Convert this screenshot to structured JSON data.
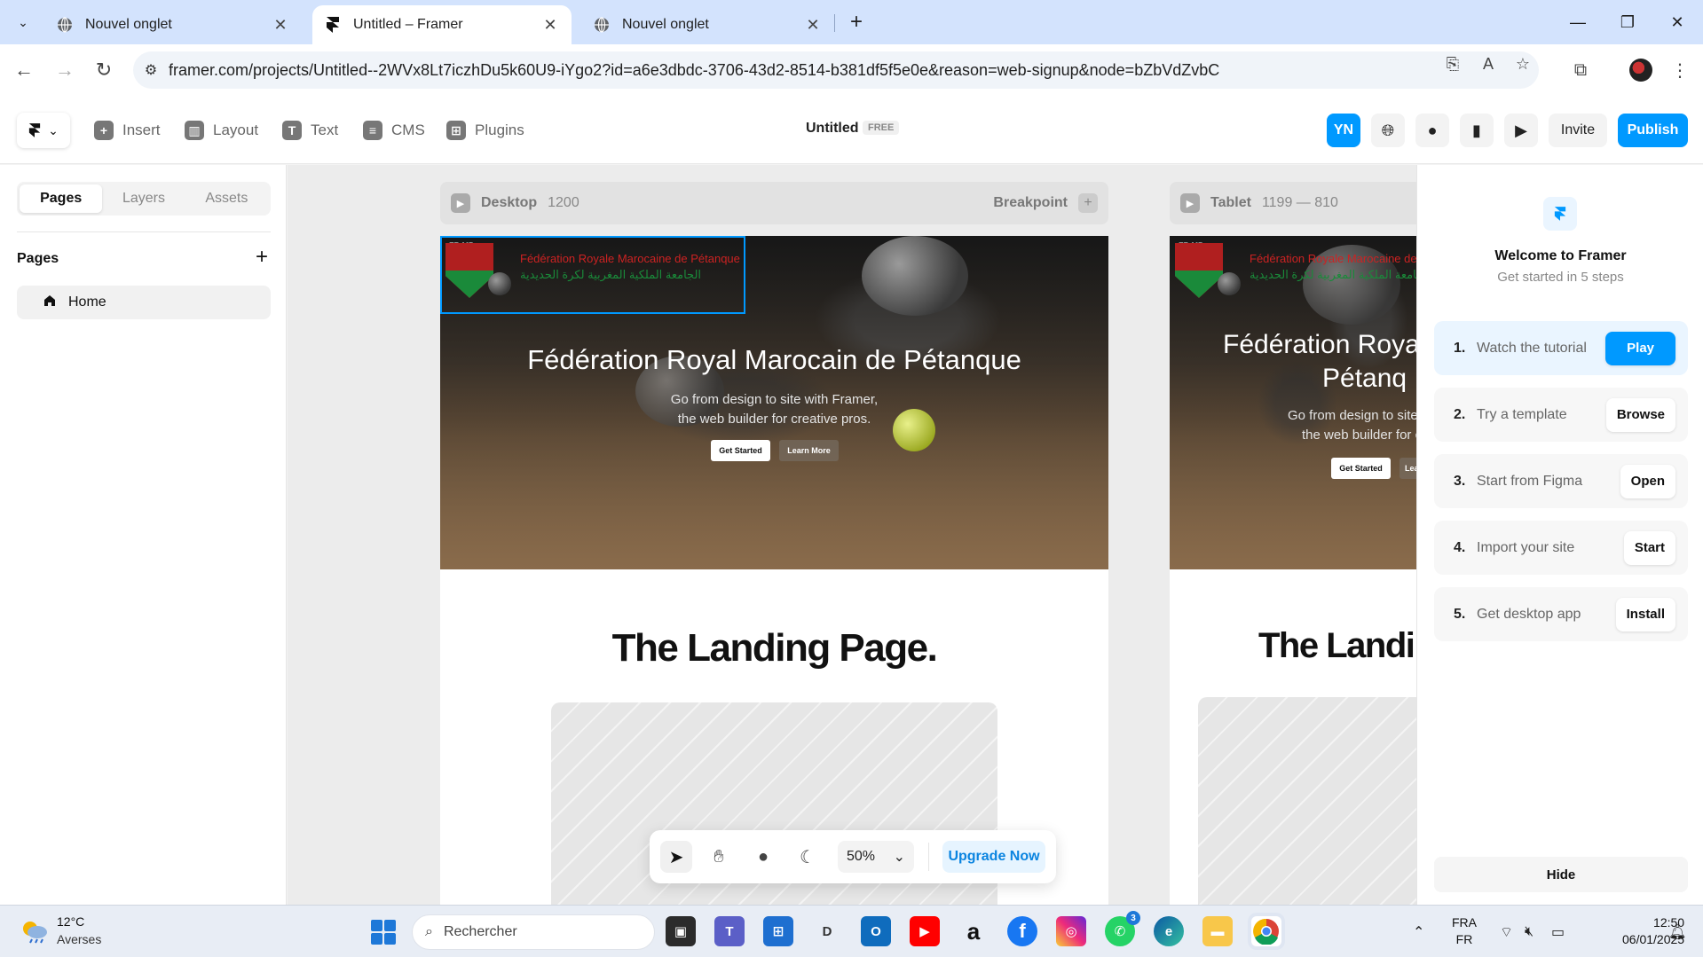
{
  "browser": {
    "tabs": [
      {
        "title": "Nouvel onglet",
        "active": false
      },
      {
        "title": "Untitled – Framer",
        "active": true
      },
      {
        "title": "Nouvel onglet",
        "active": false
      }
    ],
    "url": "framer.com/projects/Untitled--2WVx8Lt7iczhDu5k60U9-iYgo2?id=a6e3dbdc-3706-43d2-8514-b381df5f5e0e&reason=web-signup&node=bZbVdZvbC"
  },
  "framer": {
    "toolbar": {
      "insert": "Insert",
      "layout": "Layout",
      "text": "Text",
      "cms": "CMS",
      "plugins": "Plugins"
    },
    "project_title": "Untitled",
    "plan_badge": "FREE",
    "user_initials": "YN",
    "invite": "Invite",
    "publish": "Publish",
    "accent": "#0099ff"
  },
  "left_panel": {
    "tabs": [
      "Pages",
      "Layers",
      "Assets"
    ],
    "active_tab": "Pages",
    "section_title": "Pages",
    "pages": [
      {
        "name": "Home"
      }
    ]
  },
  "canvas": {
    "desktop": {
      "label": "Desktop",
      "width": "1200",
      "breakpoint": "Breakpoint"
    },
    "tablet": {
      "label": "Tablet",
      "range": "1199 — 810"
    },
    "site": {
      "logo_fr": "Fédération Royale Marocaine de Pétanque",
      "logo_ar": "الجامعة الملكية المغربية لكرة الحديدية",
      "logo_abbr": "FR MP",
      "hero_title": "Fédération Royal Marocain de Pétanque",
      "hero_title_tablet_1": "Fédération Royal",
      "hero_title_tablet_2": "Pétanq",
      "hero_sub_1": "Go from design to site with Framer,",
      "hero_sub_2": "the web builder for creative pros.",
      "hero_sub_tablet_1": "Go from design to site",
      "hero_sub_tablet_2": "the web builder for cr",
      "btn_primary": "Get Started",
      "btn_secondary": "Learn More",
      "btn_secondary_tablet": "Lear",
      "landing_title": "The Landing Page.",
      "landing_title_tablet": "The Landin"
    },
    "bottom_toolbar": {
      "zoom": "50%",
      "upgrade": "Upgrade Now"
    }
  },
  "right_panel": {
    "welcome": "Welcome to Framer",
    "subtitle": "Get started in 5 steps",
    "steps": [
      {
        "num": "1.",
        "label": "Watch the tutorial",
        "action": "Play"
      },
      {
        "num": "2.",
        "label": "Try a template",
        "action": "Browse"
      },
      {
        "num": "3.",
        "label": "Start from Figma",
        "action": "Open"
      },
      {
        "num": "4.",
        "label": "Import your site",
        "action": "Start"
      },
      {
        "num": "5.",
        "label": "Get desktop app",
        "action": "Install"
      }
    ],
    "hide": "Hide"
  },
  "taskbar": {
    "weather_temp": "12°C",
    "weather_city": "Averses",
    "search_placeholder": "Rechercher",
    "whatsapp_badge": "3",
    "lang_1": "FRA",
    "lang_2": "FR",
    "time": "12:50",
    "date": "06/01/2025"
  }
}
